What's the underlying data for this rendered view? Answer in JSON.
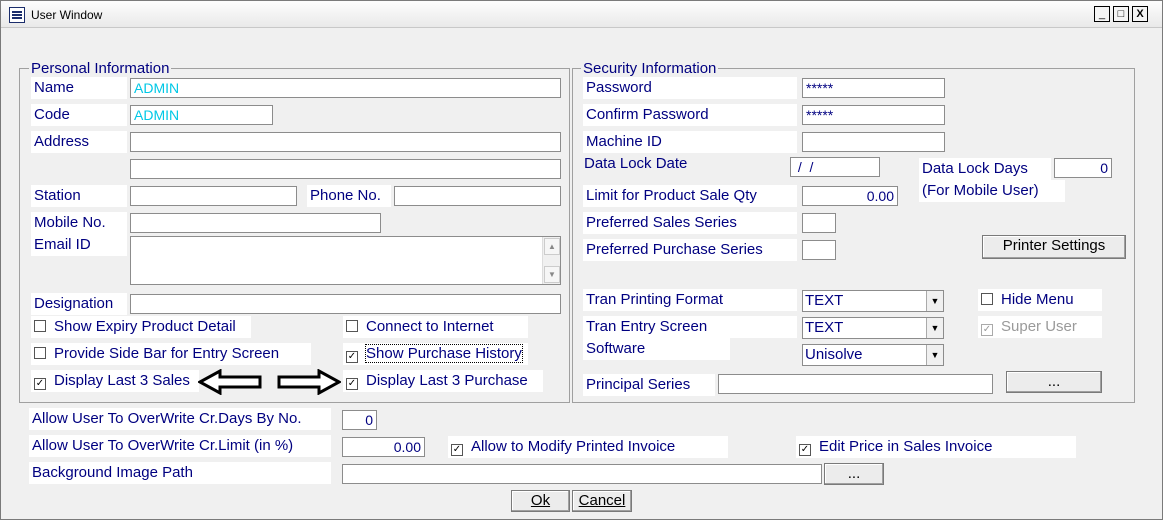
{
  "window": {
    "title": "User Window",
    "minimize": "_",
    "maximize": "□",
    "close": "X"
  },
  "personal": {
    "legend": "Personal Information",
    "name_label": "Name",
    "name_value": "ADMIN",
    "code_label": "Code",
    "code_value": "ADMIN",
    "address_label": "Address",
    "station_label": "Station",
    "phone_label": "Phone No.",
    "mobile_label": "Mobile No.",
    "email_label": "Email ID",
    "designation_label": "Designation",
    "show_expiry": "Show Expiry Product Detail",
    "connect_internet": "Connect to Internet",
    "side_bar": "Provide Side Bar for Entry Screen",
    "show_purchase_history": "Show Purchase History",
    "last3_sales": "Display Last 3 Sales",
    "last3_purchase": "Display Last 3 Purchase"
  },
  "security": {
    "legend": "Security Information",
    "password_label": "Password",
    "password_value": "*****",
    "confirm_label": "Confirm Password",
    "confirm_value": "*****",
    "machine_label": "Machine ID",
    "lock_date_label": "Data Lock Date",
    "lock_date_value": " /  /",
    "lock_days_label": "Data Lock Days",
    "lock_days_value": "0",
    "mobile_user_label": "(For Mobile User)",
    "limit_label": "Limit for Product Sale Qty",
    "limit_value": "0.00",
    "pref_sales_label": "Preferred Sales Series",
    "pref_purchase_label": "Preferred Purchase Series",
    "printer_settings": "Printer Settings",
    "tran_print_label": "Tran Printing Format",
    "tran_print_value": "TEXT",
    "tran_entry_label": "Tran Entry Screen",
    "tran_entry_value": "TEXT",
    "software_label": "Software",
    "software_value": "Unisolve",
    "hide_menu": "Hide Menu",
    "super_user": "Super User",
    "principal_label": "Principal Series",
    "principal_btn": "..."
  },
  "bottom": {
    "crdays_label": "Allow User To OverWrite Cr.Days By No.",
    "crdays_value": "0",
    "crlimit_label": "Allow User To OverWrite Cr.Limit (in %)",
    "crlimit_value": "0.00",
    "modify_printed": "Allow to Modify Printed Invoice",
    "edit_price": "Edit Price in Sales Invoice",
    "bg_label": "Background Image Path",
    "bg_btn": "...",
    "ok": "Ok",
    "cancel": "Cancel"
  },
  "checkbox_states": {
    "show_expiry": false,
    "connect_internet": false,
    "side_bar": false,
    "show_purchase_history": true,
    "last3_sales": true,
    "last3_purchase": true,
    "hide_menu": false,
    "super_user": true,
    "modify_printed": true,
    "edit_price": true
  },
  "icons": [
    "app-menu-icon",
    "minimize-icon",
    "maximize-icon",
    "close-icon",
    "left-arrow-icon",
    "right-arrow-icon",
    "dropdown-arrow-icon",
    "scroll-up-icon",
    "scroll-down-icon",
    "checkmark-icon"
  ]
}
